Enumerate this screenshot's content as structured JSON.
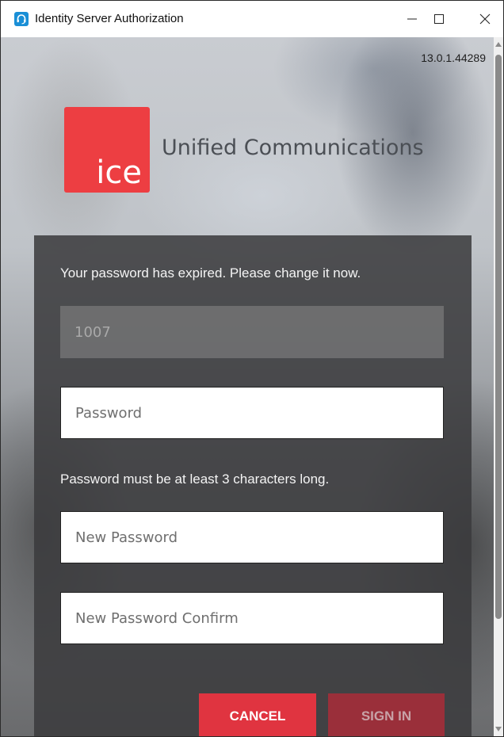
{
  "window": {
    "title": "Identity Server Authorization",
    "app_icon": "headset-icon",
    "controls": {
      "minimize_icon": "minimize-icon",
      "maximize_icon": "maximize-icon",
      "close_icon": "close-icon"
    }
  },
  "header": {
    "version": "13.0.1.44289",
    "logo_text": "ice",
    "brand_name": "Unified Communications",
    "logo_color": "#ed3e42"
  },
  "form": {
    "expired_message": "Your password has expired. Please change it now.",
    "username_value": "1007",
    "password_placeholder": "Password",
    "hint_message": "Password must be at least 3 characters long.",
    "new_password_placeholder": "New Password",
    "new_password_confirm_placeholder": "New Password Confirm",
    "cancel_label": "CANCEL",
    "signin_label": "SIGN IN",
    "accent_color": "#e03440"
  }
}
